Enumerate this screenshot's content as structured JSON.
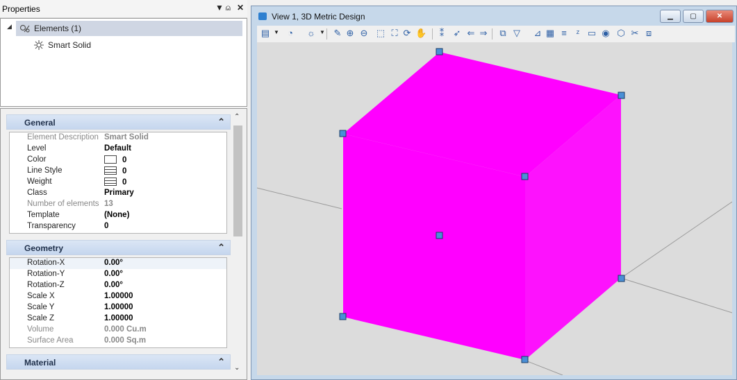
{
  "properties": {
    "title": "Properties",
    "pin": "⩄",
    "close": "✕",
    "dropdown": "▼",
    "tree": {
      "expander": "◢",
      "root_label": "Elements (1)",
      "child_label": "Smart Solid"
    },
    "groups": {
      "general": {
        "title": "General",
        "rows": [
          {
            "key": "Element Description",
            "value": "Smart Solid"
          },
          {
            "key": "Level",
            "value": "Default"
          },
          {
            "key": "Color",
            "value": "0"
          },
          {
            "key": "Line Style",
            "value": "0"
          },
          {
            "key": "Weight",
            "value": "0"
          },
          {
            "key": "Class",
            "value": "Primary"
          },
          {
            "key": "Number of elements",
            "value": "13"
          },
          {
            "key": "Template",
            "value": "(None)"
          },
          {
            "key": "Transparency",
            "value": "0"
          }
        ]
      },
      "geometry": {
        "title": "Geometry",
        "rows": [
          {
            "key": "Rotation-X",
            "value": "0.00°"
          },
          {
            "key": "Rotation-Y",
            "value": "0.00°"
          },
          {
            "key": "Rotation-Z",
            "value": "0.00°"
          },
          {
            "key": "Scale X",
            "value": "1.00000"
          },
          {
            "key": "Scale Y",
            "value": "1.00000"
          },
          {
            "key": "Scale Z",
            "value": "1.00000"
          },
          {
            "key": "Volume",
            "value": "0.000 Cu.m"
          },
          {
            "key": "Surface Area",
            "value": "0.000 Sq.m"
          }
        ]
      },
      "material": {
        "title": "Material"
      }
    }
  },
  "view": {
    "title": "View 1, 3D Metric Design",
    "solid_color": "#ff00ff",
    "handle_color": "#4a8fd6",
    "background_color": "#dcdcdc",
    "toolbar_icons": [
      "view-attributes-icon",
      "display-style-icon",
      "lighting-icon",
      "update-view-icon",
      "zoom-in-icon",
      "zoom-out-icon",
      "window-area-icon",
      "fit-view-icon",
      "rotate-view-icon",
      "pan-view-icon",
      "walk-icon",
      "fly-icon",
      "previous-view-icon",
      "next-view-icon",
      "toggle-camera-icon",
      "clip-volume-icon",
      "clip-mask-icon",
      "view-settings-icon",
      "level-display-icon",
      "z-depth-icon",
      "set-view-icon",
      "save-view-icon",
      "view-cube-icon",
      "cut-icon",
      "copy-view-icon"
    ]
  }
}
